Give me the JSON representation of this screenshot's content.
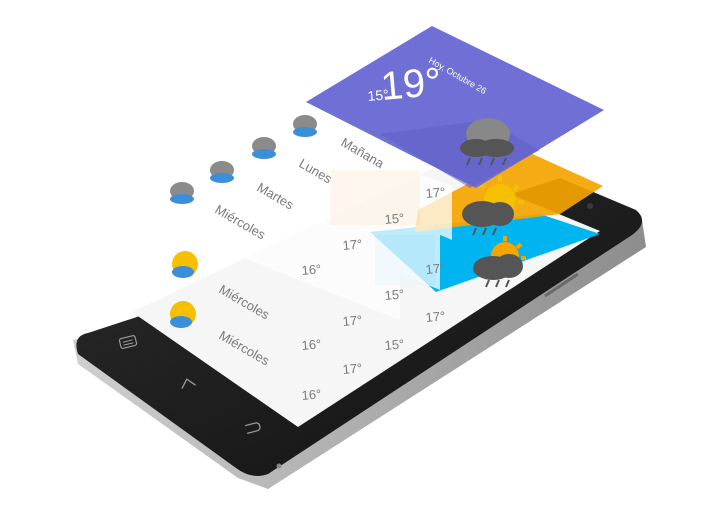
{
  "header_card": {
    "date": "Hoy, Octubre 26",
    "temp_big": "19°",
    "temp_small": "15°",
    "color": "#6f6fd6",
    "icon": "cloud-rain-icon"
  },
  "orange_card": {
    "color": "#f4a500",
    "icon": "sun-cloud-rain-icon"
  },
  "blue_card": {
    "color": "#00b4f0",
    "icon": "sun-cloud-rain-icon"
  },
  "floating_rows": [
    {
      "day": "Mañana",
      "icon": "cloud-rain-icon",
      "temp": "17°"
    },
    {
      "day": "Lunes",
      "icon": "cloud-rain-icon",
      "temp": "15°"
    },
    {
      "day": "Martes",
      "icon": "cloud-rain-icon",
      "temp": "17°"
    },
    {
      "day": "Miércoles",
      "icon": "cloud-rain-icon",
      "temp": "16°"
    }
  ],
  "screen_rows": [
    {
      "day": "Miércoles",
      "temp_a": "17°",
      "temp_b": "15°",
      "temp_c": "17°",
      "icon": "sun-cloud-icon"
    },
    {
      "day": "Miércoles",
      "temp_a": "16°",
      "temp_b": "15°",
      "temp_c": "17°",
      "icon": "sun-cloud-icon"
    },
    {
      "day": "",
      "temp_a": "16°",
      "temp_b": "",
      "temp_c": "",
      "icon": ""
    }
  ],
  "phone": {
    "body_color": "#1f1f1f",
    "buttons": [
      "menu-button-icon",
      "home-button-icon",
      "back-button-icon"
    ]
  }
}
